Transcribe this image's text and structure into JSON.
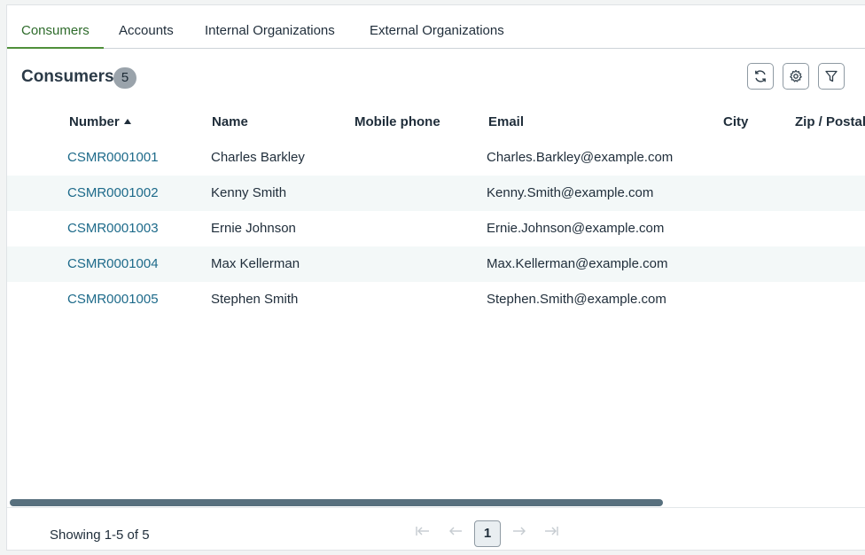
{
  "tabs": [
    {
      "label": "Consumers",
      "active": true
    },
    {
      "label": "Accounts",
      "active": false
    },
    {
      "label": "Internal Organizations",
      "active": false
    },
    {
      "label": "External Organizations",
      "active": false
    }
  ],
  "list": {
    "title": "Consumers",
    "count": "5",
    "tools": {
      "refresh_icon": "refresh-icon",
      "settings_icon": "gear-icon",
      "filter_icon": "filter-icon"
    }
  },
  "table": {
    "columns": [
      "Number",
      "Name",
      "Mobile phone",
      "Email",
      "City",
      "Zip / Postal"
    ],
    "sort_column": "Number",
    "sort_direction": "ascending",
    "rows": [
      {
        "number": "CSMR0001001",
        "name": "Charles Barkley",
        "mobile": "",
        "email": "Charles.Barkley@example.com",
        "city": "",
        "zip": ""
      },
      {
        "number": "CSMR0001002",
        "name": "Kenny Smith",
        "mobile": "",
        "email": "Kenny.Smith@example.com",
        "city": "",
        "zip": ""
      },
      {
        "number": "CSMR0001003",
        "name": "Ernie Johnson",
        "mobile": "",
        "email": "Ernie.Johnson@example.com",
        "city": "",
        "zip": ""
      },
      {
        "number": "CSMR0001004",
        "name": "Max Kellerman",
        "mobile": "",
        "email": "Max.Kellerman@example.com",
        "city": "",
        "zip": ""
      },
      {
        "number": "CSMR0001005",
        "name": "Stephen Smith",
        "mobile": "",
        "email": "Stephen.Smith@example.com",
        "city": "",
        "zip": ""
      }
    ]
  },
  "footer": {
    "showing": "Showing 1-5 of 5",
    "current_page": "1"
  },
  "colors": {
    "active_tab": "#2e6b2b",
    "link": "#1d6a8a",
    "row_alt": "#f3f8f8",
    "scrollbar": "#58707e"
  }
}
